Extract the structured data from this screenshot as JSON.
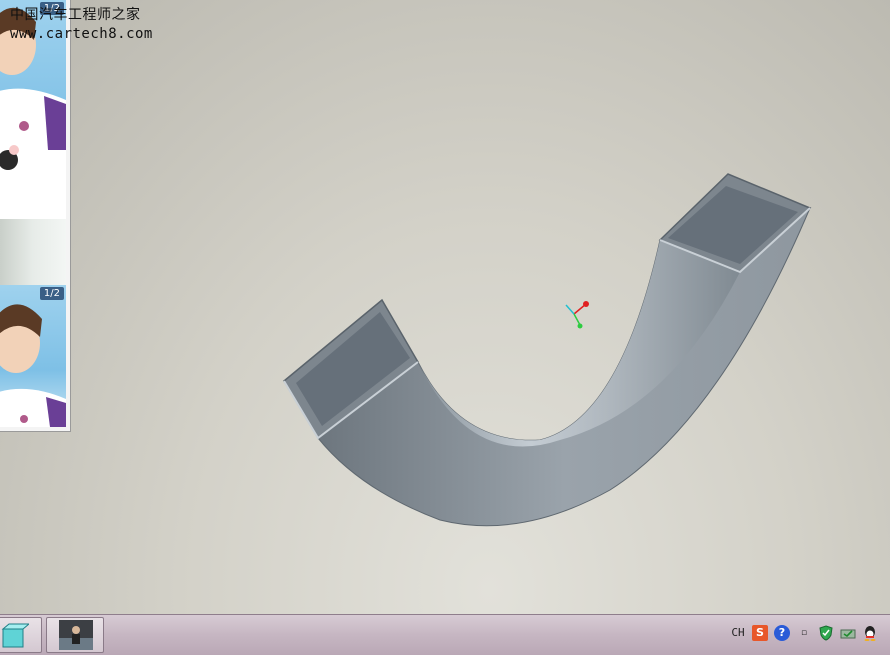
{
  "watermark": {
    "line1": "中国汽车工程师之家",
    "line2": "www.cartech8.com"
  },
  "side_panel": {
    "thumbnails": [
      {
        "page_badge": "1/2"
      },
      {
        "page_badge": "1/2"
      }
    ]
  },
  "viewport": {
    "model": "swept-rectangular-channel-icon",
    "triad": {
      "x_color": "#e02020",
      "y_color": "#2ecc40",
      "z_color": "#20c0d0"
    }
  },
  "taskbar": {
    "buttons": [
      {
        "icon": "cube-icon"
      },
      {
        "icon": "video-thumbnail-icon"
      }
    ],
    "tray": {
      "lang_label": "CH",
      "icons": [
        "sogou-ime-icon",
        "help-icon",
        "ime-options-icon",
        "security-shield-icon",
        "network-icon",
        "qq-icon"
      ]
    }
  }
}
